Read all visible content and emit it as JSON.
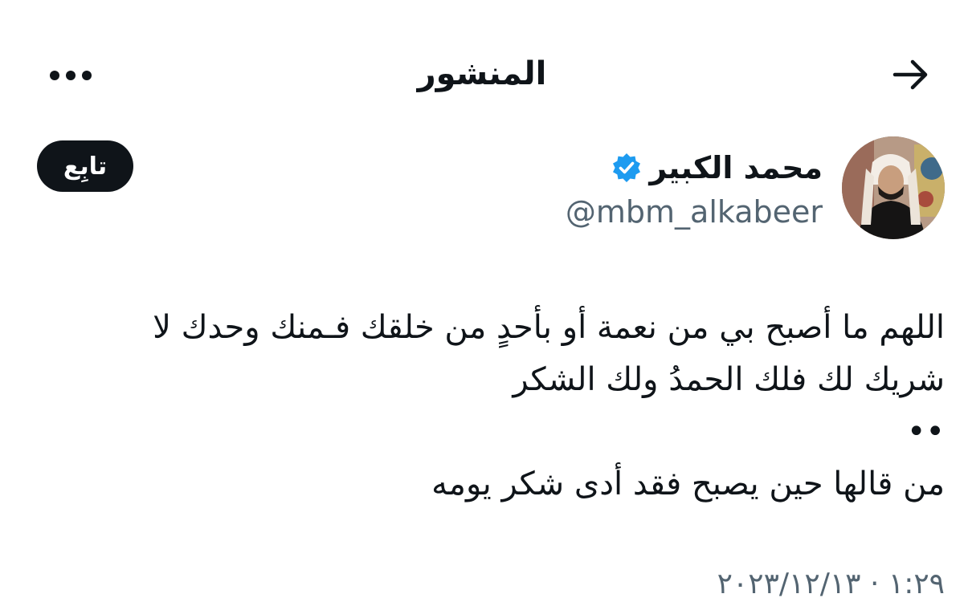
{
  "header": {
    "title": "المنشور",
    "back_icon": "arrow-right-icon",
    "more_icon": "more-horizontal-icon"
  },
  "author": {
    "name": "محمد الكبير",
    "handle": "@mbm_alkabeer",
    "verified": true,
    "verified_icon": "verified-badge-icon",
    "follow_label": "تابِع"
  },
  "post": {
    "lines": [
      "اللهم ما أصبح بي من نعمة أو بأحدٍ من خلقك فـمنك وحدك لا",
      "شريك لك فلك الحمدُ ولك الشكر",
      "••",
      "من قالها حين يصبح فقد أدى شكر يومه"
    ]
  },
  "meta": {
    "timestamp_partial": "١:٢٩ · ٢٠٢٣/١٢/١٣"
  },
  "colors": {
    "text_primary": "#0f1419",
    "text_secondary": "#536471",
    "verified_blue": "#1d9bf0",
    "follow_bg": "#0f1419"
  }
}
